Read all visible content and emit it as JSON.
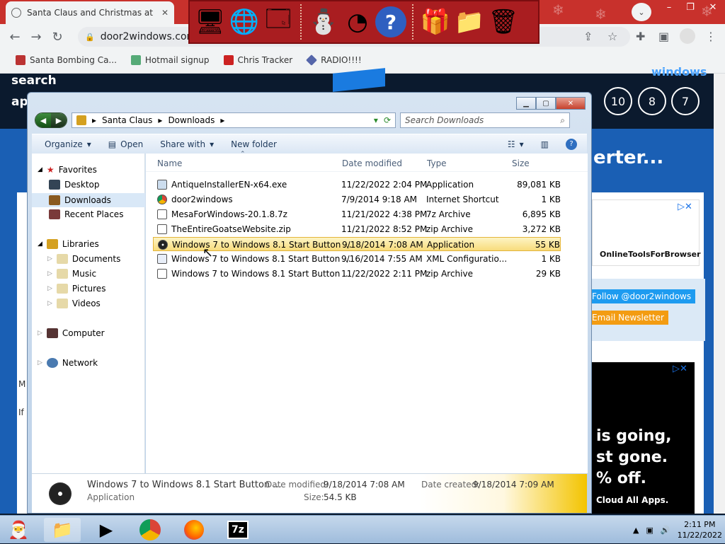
{
  "browser": {
    "tab_title": "Santa Claus and Christmas at the",
    "url": "door2windows.com",
    "bookmarks": [
      "Santa Bombing Ca...",
      "Hotmail signup",
      "Chris Tracker",
      "RADIO!!!!"
    ]
  },
  "page_behind": {
    "search": "search",
    "ap": "ap",
    "windows": "windows",
    "circles": [
      "10",
      "8",
      "7"
    ],
    "erter": "erter...",
    "ad1_name": "OnlineToolsForBrowser",
    "follow": "Follow @door2windows",
    "newsletter": "Email Newsletter",
    "ad2_lines": [
      "is going,",
      "st gone.",
      "% off.",
      "Cloud All Apps."
    ],
    "m": "M",
    "if": "If"
  },
  "explorer": {
    "breadcrumb": [
      "Santa Claus",
      "Downloads"
    ],
    "search_placeholder": "Search Downloads",
    "commands": {
      "organize": "Organize",
      "open": "Open",
      "share": "Share with",
      "new_folder": "New folder"
    },
    "nav": {
      "favorites": "Favorites",
      "desktop": "Desktop",
      "downloads": "Downloads",
      "recent": "Recent Places",
      "libraries": "Libraries",
      "documents": "Documents",
      "music": "Music",
      "pictures": "Pictures",
      "videos": "Videos",
      "computer": "Computer",
      "network": "Network"
    },
    "columns": {
      "name": "Name",
      "date": "Date modified",
      "type": "Type",
      "size": "Size"
    },
    "files": [
      {
        "name": "AntiqueInstallerEN-x64.exe",
        "date": "11/22/2022 2:04 PM",
        "type": "Application",
        "size": "89,081 KB"
      },
      {
        "name": "door2windows",
        "date": "7/9/2014 9:18 AM",
        "type": "Internet Shortcut",
        "size": "1 KB"
      },
      {
        "name": "MesaForWindows-20.1.8.7z",
        "date": "11/21/2022 4:38 PM",
        "type": "7z Archive",
        "size": "6,895 KB"
      },
      {
        "name": "TheEntireGoatseWebsite.zip",
        "date": "11/21/2022 8:52 PM",
        "type": "zip Archive",
        "size": "3,272 KB"
      },
      {
        "name": "Windows 7 to Windows 8.1 Start Button ...",
        "date": "9/18/2014 7:08 AM",
        "type": "Application",
        "size": "55 KB"
      },
      {
        "name": "Windows 7 to Windows 8.1 Start Button ...",
        "date": "9/16/2014 7:55 AM",
        "type": "XML Configuratio...",
        "size": "1 KB"
      },
      {
        "name": "Windows 7 to Windows 8.1 Start Button ...",
        "date": "11/22/2022 2:11 PM",
        "type": "zip Archive",
        "size": "29 KB"
      }
    ],
    "details": {
      "name": "Windows 7 to Windows 8.1 Start Button ...",
      "type": "Application",
      "date_modified_label": "Date modified:",
      "date_modified": "9/18/2014 7:08 AM",
      "size_label": "Size:",
      "size": "54.5 KB",
      "date_created_label": "Date created:",
      "date_created": "9/18/2014 7:09 AM"
    }
  },
  "taskbar": {
    "time": "2:11 PM",
    "date": "11/22/2022",
    "sevenzip": "7z"
  }
}
